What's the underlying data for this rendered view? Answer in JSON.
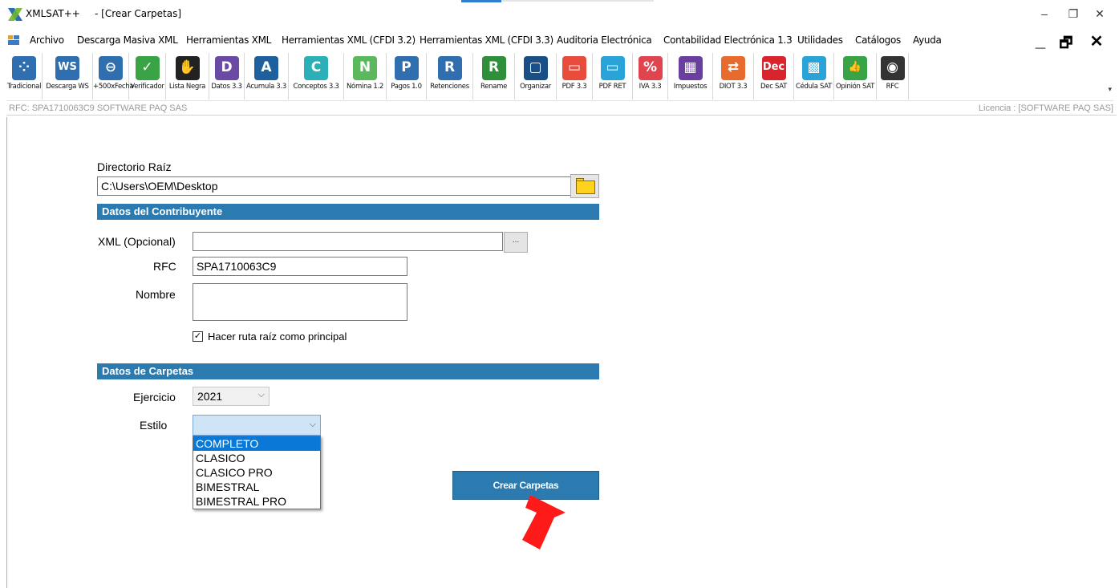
{
  "window": {
    "app_name": "XMLSAT++",
    "doc_title": "- [Crear Carpetas]",
    "minimize_glyph": "–",
    "restore_glyph": "❐",
    "close_glyph": "✕"
  },
  "menu": {
    "items": [
      "Archivo",
      "Descarga Masiva XML",
      "Herramientas XML",
      "Herramientas XML (CFDI 3.2)",
      "Herramientas XML (CFDI 3.3)",
      "Auditoria Electrónica",
      "Contabilidad Electrónica 1.3",
      "Utilidades",
      "Catálogos",
      "Ayuda"
    ],
    "mdi_minimize": "_",
    "mdi_restore": "🗗",
    "mdi_close": "✕"
  },
  "toolbar": {
    "items": [
      {
        "label": "Tradicional",
        "icon": "grid-icon",
        "glyph": "⁘",
        "color": "#2f6fb0"
      },
      {
        "label": "Descarga WS",
        "icon": "ws-icon",
        "glyph": "WS",
        "color": "#2f6fb0"
      },
      {
        "label": "+500xFecha",
        "icon": "link-icon",
        "glyph": "⊖",
        "color": "#2f6fb0"
      },
      {
        "label": "Verificador",
        "icon": "check-icon",
        "glyph": "✓",
        "color": "#3aa345"
      },
      {
        "label": "Lista Negra",
        "icon": "hand-icon",
        "glyph": "✋",
        "color": "#222222"
      },
      {
        "label": "Datos 3.3",
        "icon": "datos-icon",
        "glyph": "D",
        "color": "#6b4aa6"
      },
      {
        "label": "Acumula 3.3",
        "icon": "acumula-icon",
        "glyph": "A",
        "color": "#1e5f9e"
      },
      {
        "label": "Conceptos 3.3",
        "icon": "conceptos-icon",
        "glyph": "C",
        "color": "#2bb0b8"
      },
      {
        "label": "Nómina 1.2",
        "icon": "nomina-icon",
        "glyph": "N",
        "color": "#5cb85c"
      },
      {
        "label": "Pagos 1.0",
        "icon": "pagos-icon",
        "glyph": "P",
        "color": "#2f6fb0"
      },
      {
        "label": "Retenciones",
        "icon": "retenciones-icon",
        "glyph": "R",
        "color": "#2f6fb0"
      },
      {
        "label": "Rename",
        "icon": "rename-icon",
        "glyph": "R",
        "color": "#2f8f3a"
      },
      {
        "label": "Organizar",
        "icon": "organizar-icon",
        "glyph": "▢",
        "color": "#1a4f86"
      },
      {
        "label": "PDF 3.3",
        "icon": "pdf-icon",
        "glyph": "▭",
        "color": "#e74c3c"
      },
      {
        "label": "PDF RET",
        "icon": "pdf-ret-icon",
        "glyph": "▭",
        "color": "#2aa3d8"
      },
      {
        "label": "IVA 3.3",
        "icon": "percent-icon",
        "glyph": "%",
        "color": "#e0454f"
      },
      {
        "label": "Impuestos",
        "icon": "calculator-icon",
        "glyph": "▦",
        "color": "#6b3fa0"
      },
      {
        "label": "DIOT 3.3",
        "icon": "handshake-icon",
        "glyph": "⇄",
        "color": "#e86a2c"
      },
      {
        "label": "Dec SAT",
        "icon": "dec-icon",
        "glyph": "Dec",
        "color": "#d9232d"
      },
      {
        "label": "Cédula SAT",
        "icon": "qr-icon",
        "glyph": "▩",
        "color": "#2aa3d8"
      },
      {
        "label": "Opinión SAT",
        "icon": "thumbs-up-icon",
        "glyph": "👍",
        "color": "#3aa345"
      },
      {
        "label": "RFC",
        "icon": "person-icon",
        "glyph": "◉",
        "color": "#333333"
      }
    ]
  },
  "status": {
    "rfc_text": "RFC: SPA1710063C9 SOFTWARE PAQ SAS",
    "license_text": "Licencia : [SOFTWARE PAQ SAS]"
  },
  "form": {
    "root_label": "Directorio Raíz",
    "root_value": "C:\\Users\\OEM\\Desktop",
    "section_taxpayer": "Datos del Contribuyente",
    "xml_label": "XML (Opcional)",
    "xml_value": "",
    "browse_label": "...",
    "rfc_label": "RFC",
    "rfc_value": "SPA1710063C9",
    "name_label": "Nombre",
    "name_value": "",
    "root_principal_label": "Hacer ruta raíz como principal",
    "root_principal_checked": true,
    "section_folders": "Datos de Carpetas",
    "year_label": "Ejercicio",
    "year_value": "2021",
    "style_label": "Estilo",
    "style_value": "",
    "style_options": [
      "COMPLETO",
      "CLASICO",
      "CLASICO PRO",
      "BIMESTRAL",
      "BIMESTRAL PRO"
    ],
    "style_highlighted": "COMPLETO",
    "create_button": "Crear Carpetas"
  },
  "colors": {
    "section_bar": "#2b7bb0",
    "highlight": "#0a78d7",
    "arrow": "#ff1a1a"
  }
}
